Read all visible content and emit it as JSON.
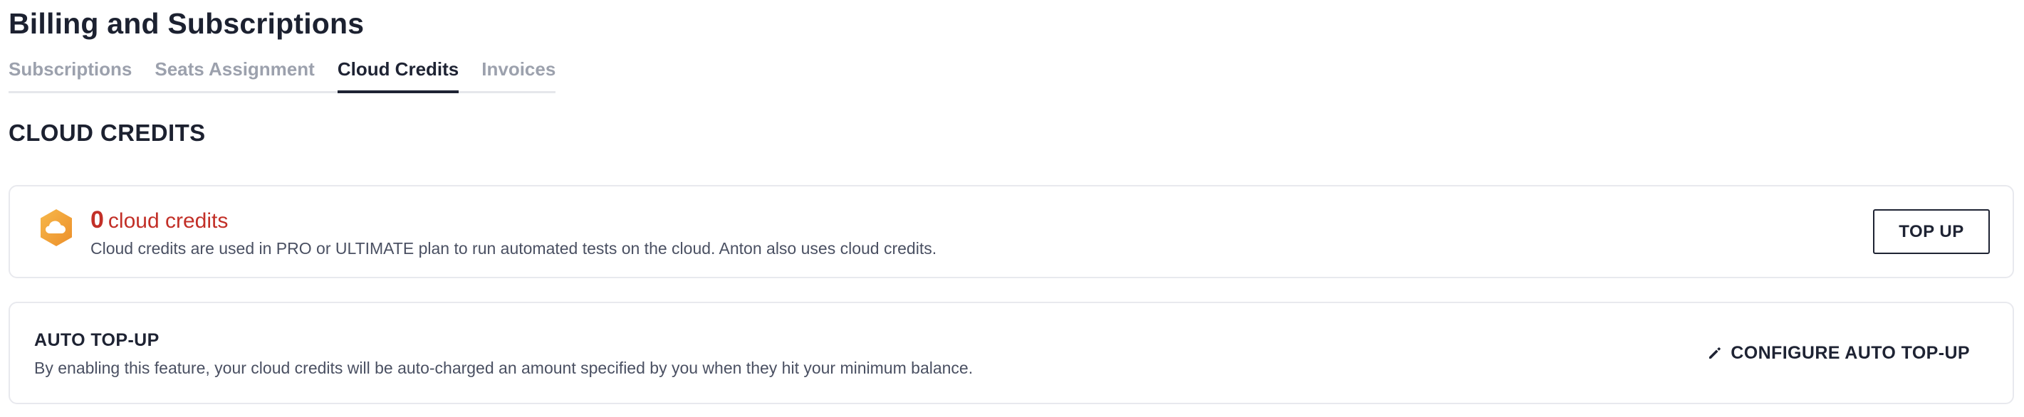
{
  "page": {
    "title": "Billing and Subscriptions"
  },
  "tabs": [
    {
      "label": "Subscriptions",
      "active": false
    },
    {
      "label": "Seats Assignment",
      "active": false
    },
    {
      "label": "Cloud Credits",
      "active": true
    },
    {
      "label": "Invoices",
      "active": false
    }
  ],
  "section": {
    "title": "CLOUD CREDITS"
  },
  "credits_card": {
    "icon": "cloud-credit-icon",
    "amount": "0",
    "unit": "cloud credits",
    "description": "Cloud credits are used in PRO or ULTIMATE plan to run automated tests on the cloud. Anton also uses cloud credits.",
    "top_up_label": "TOP UP"
  },
  "auto_top_up_card": {
    "title": "AUTO TOP-UP",
    "description": "By enabling this feature, your cloud credits will be auto-charged an amount specified by you when they hit your minimum balance.",
    "configure_label": "CONFIGURE AUTO TOP-UP",
    "configure_icon": "pencil-icon"
  },
  "colors": {
    "text_primary": "#1e2333",
    "text_muted": "#9ca1ad",
    "credit_red": "#c22f27",
    "icon_orange": "#f0a33a",
    "border": "#e8e9ee"
  }
}
